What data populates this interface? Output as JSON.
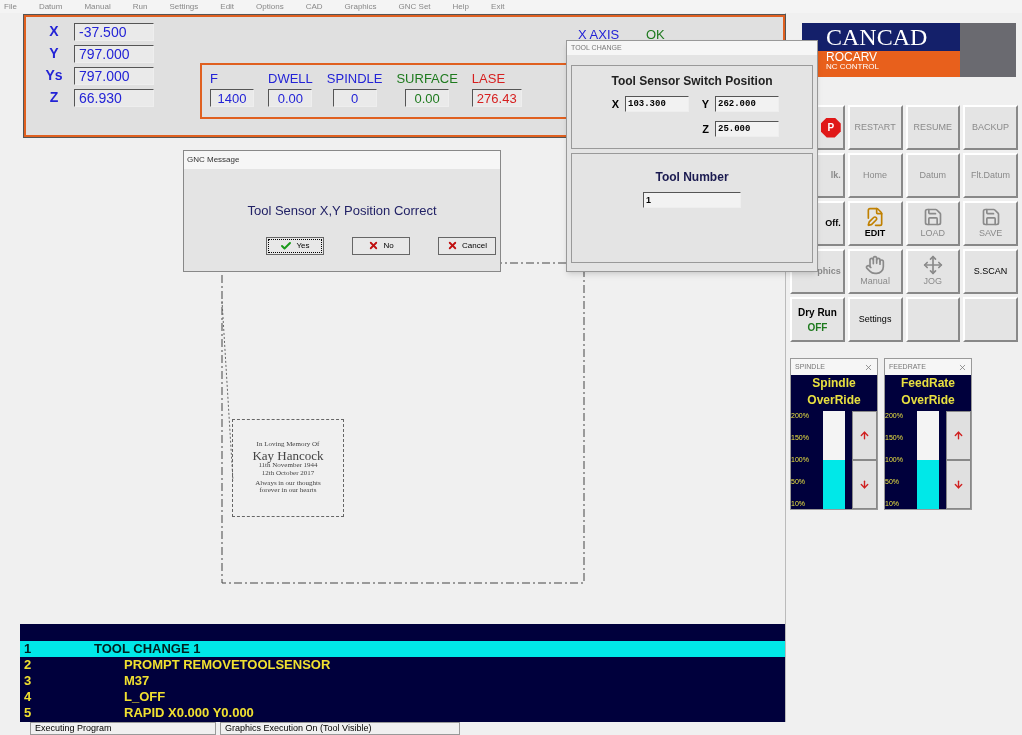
{
  "menu": [
    "File",
    "Datum",
    "Manual",
    "Run",
    "Settings",
    "Edit",
    "Options",
    "CAD",
    "Graphics",
    "GNC Set",
    "Help",
    "Exit"
  ],
  "axes": [
    {
      "label": "X",
      "value": "-37.500"
    },
    {
      "label": "Y",
      "value": "797.000"
    },
    {
      "label": "Ys",
      "value": "797.000"
    },
    {
      "label": "Z",
      "value": "66.930"
    }
  ],
  "axis_status": {
    "label": "X AXIS",
    "status": "OK"
  },
  "parameters": [
    {
      "label": "F",
      "value": "1400",
      "color": "#2323d6"
    },
    {
      "label": "DWELL",
      "value": "0.00",
      "color": "#2323d6"
    },
    {
      "label": "SPINDLE",
      "value": "0",
      "color": "#2323d6"
    },
    {
      "label": "SURFACE",
      "value": "0.00",
      "color": "#1e7a1e"
    },
    {
      "label": "LASE",
      "value": "276.43",
      "color": "#d62020"
    }
  ],
  "canvas": {
    "engraving": [
      "In Loving Memory Of",
      "Kay Hancock",
      "11th November 1944",
      "12th October 2017",
      "Always in our thoughts",
      "forever in our hearts"
    ]
  },
  "program": {
    "lines": [
      {
        "number": "1",
        "text": "TOOL CHANGE 1",
        "selected": true,
        "children": [
          {
            "number": "2",
            "text": "PROMPT REMOVETOOLSENSOR",
            "selected": false
          },
          {
            "number": "3",
            "text": "M37",
            "selected": false
          },
          {
            "number": "4",
            "text": "L_OFF",
            "selected": false
          },
          {
            "number": "5",
            "text": "RAPID X0.000 Y0.000",
            "selected": false
          }
        ]
      }
    ]
  },
  "status_bar": [
    "Executing Program",
    "Graphics Execution On (Tool Visible)"
  ],
  "logo": {
    "title": "CANCAD",
    "subtitle": "ROCARV",
    "tagline": "NC CONTROL"
  },
  "buttons": [
    {
      "kind": "stop",
      "label": "P"
    },
    {
      "kind": "text",
      "label": "RESTART",
      "disabled": true
    },
    {
      "kind": "text",
      "label": "RESUME",
      "disabled": true
    },
    {
      "kind": "text",
      "label": "BACKUP",
      "disabled": true
    },
    {
      "kind": "text",
      "label": "lk.",
      "disabled": true
    },
    {
      "kind": "text",
      "label": "Home",
      "disabled": true
    },
    {
      "kind": "text",
      "label": "Datum",
      "disabled": true
    },
    {
      "kind": "text",
      "label": "Flt.Datum",
      "disabled": true
    },
    {
      "kind": "text",
      "label": "Off.",
      "disabled": false
    },
    {
      "kind": "edit",
      "label": "EDIT",
      "disabled": false
    },
    {
      "kind": "load",
      "label": "LOAD",
      "disabled": true
    },
    {
      "kind": "save",
      "label": "SAVE",
      "disabled": true
    },
    {
      "kind": "text",
      "label": "phics",
      "disabled": true
    },
    {
      "kind": "manual",
      "label": "Manual",
      "disabled": true
    },
    {
      "kind": "jog",
      "label": "JOG",
      "disabled": true
    },
    {
      "kind": "text",
      "label": "S.SCAN",
      "disabled": false
    },
    {
      "kind": "dryrun",
      "label": "Dry Run",
      "status": "OFF",
      "disabled": false
    },
    {
      "kind": "text",
      "label": "Settings",
      "disabled": false
    },
    {
      "kind": "empty"
    },
    {
      "kind": "empty"
    }
  ],
  "overrides": [
    {
      "title": "SPINDLE",
      "heading": [
        "Spindle",
        "OverRide"
      ],
      "ticks": [
        "200%",
        "150%",
        "100%",
        "50%",
        "10%"
      ],
      "level": 0.5
    },
    {
      "title": "FEEDRATE",
      "heading": [
        "FeedRate",
        "OverRide"
      ],
      "ticks": [
        "200%",
        "150%",
        "100%",
        "50%",
        "10%"
      ],
      "level": 0.5
    }
  ],
  "tool_change": {
    "title": "TOOL CHANGE",
    "heading": "Tool Sensor Switch Position",
    "fields": [
      {
        "label": "X",
        "value": "103.300"
      },
      {
        "label": "Y",
        "value": "262.000"
      },
      {
        "label": "Z",
        "value": "25.000"
      }
    ],
    "tool_number": {
      "label": "Tool Number",
      "value": "1"
    }
  },
  "message": {
    "title": "GNC Message",
    "text": "Tool Sensor X,Y Position Correct",
    "buttons": [
      {
        "kind": "yes",
        "label": "Yes",
        "selected": true
      },
      {
        "kind": "no",
        "label": "No",
        "selected": false
      },
      {
        "kind": "cancel",
        "label": "Cancel",
        "selected": false
      }
    ]
  }
}
